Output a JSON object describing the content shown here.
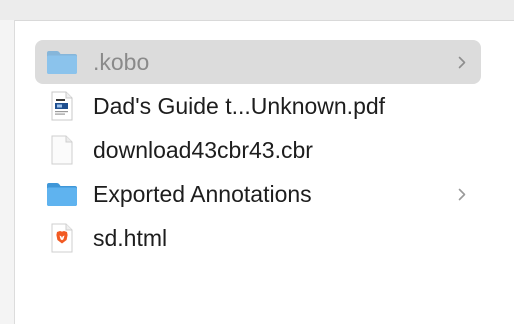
{
  "file_list": {
    "items": [
      {
        "name": ".kobo",
        "kind": "folder",
        "icon": "folder-icon",
        "selected": true,
        "has_chevron": true
      },
      {
        "name": "Dad's Guide t...Unknown.pdf",
        "kind": "pdf",
        "icon": "pdf-file-icon",
        "selected": false,
        "has_chevron": false
      },
      {
        "name": "download43cbr43.cbr",
        "kind": "file",
        "icon": "generic-file-icon",
        "selected": false,
        "has_chevron": false
      },
      {
        "name": "Exported Annotations",
        "kind": "folder",
        "icon": "folder-icon",
        "selected": false,
        "has_chevron": true
      },
      {
        "name": "sd.html",
        "kind": "html",
        "icon": "brave-html-file-icon",
        "selected": false,
        "has_chevron": false
      }
    ]
  },
  "colors": {
    "folder_blue": "#5fb3ef",
    "folder_blue_dark": "#3f97d8",
    "selection_bg": "#dcdcdc",
    "brave_orange": "#f25a23"
  }
}
